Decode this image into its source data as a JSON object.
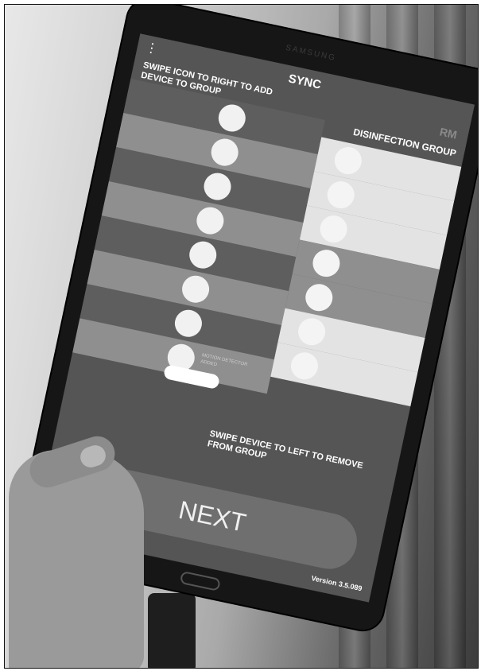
{
  "app": {
    "title": "SYNC",
    "room_label": "RM",
    "brand": "SAMSUNG",
    "menu_icon": "kebab-menu-icon"
  },
  "instructions": {
    "top": "SWIPE ICON TO RIGHT TO ADD DEVICE TO GROUP",
    "bottom": "SWIPE DEVICE TO LEFT TO REMOVE FROM GROUP"
  },
  "group": {
    "title": "DISINFECTION GROUP",
    "items": [
      {
        "label": ""
      },
      {
        "label": ""
      },
      {
        "label": ""
      },
      {
        "label": ""
      },
      {
        "label": ""
      },
      {
        "label": ""
      },
      {
        "label": ""
      }
    ]
  },
  "devices": [
    {
      "label": ""
    },
    {
      "label": ""
    },
    {
      "label": ""
    },
    {
      "label": ""
    },
    {
      "label": ""
    },
    {
      "label": ""
    },
    {
      "label": ""
    },
    {
      "label": "MOTION DETECTOR ADDED"
    }
  ],
  "actions": {
    "next_label": "NEXT"
  },
  "footer": {
    "version": "Version 3.5.089"
  },
  "colors": {
    "row_dark": "#5e5e5e",
    "row_light": "#8f8f8f",
    "group_panel": "#e3e3e3",
    "accent_white": "#ffffff"
  }
}
